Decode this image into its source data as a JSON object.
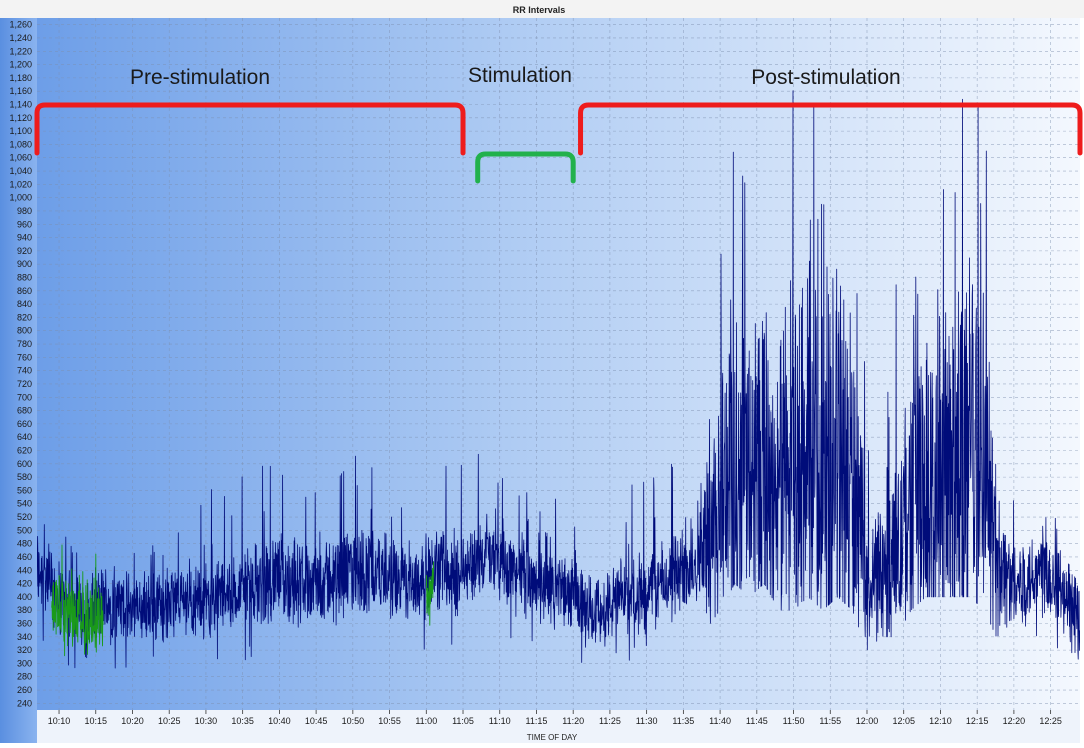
{
  "chart_data": {
    "type": "line",
    "title": "RR Intervals",
    "xlabel": "TIME OF DAY",
    "ylabel": "",
    "ylim": [
      230,
      1270
    ],
    "xlim_minutes": [
      607,
      749
    ],
    "y_ticks": [
      240,
      260,
      280,
      300,
      320,
      340,
      360,
      380,
      400,
      420,
      440,
      460,
      480,
      500,
      520,
      540,
      560,
      580,
      600,
      620,
      640,
      660,
      680,
      700,
      720,
      740,
      760,
      780,
      800,
      820,
      840,
      860,
      880,
      900,
      920,
      940,
      960,
      980,
      1000,
      1020,
      1040,
      1060,
      1080,
      1100,
      1120,
      1140,
      1160,
      1180,
      1200,
      1220,
      1240,
      1260
    ],
    "y_tick_labels": [
      "240",
      "260",
      "280",
      "300",
      "320",
      "340",
      "360",
      "380",
      "400",
      "420",
      "440",
      "460",
      "480",
      "500",
      "520",
      "540",
      "560",
      "580",
      "600",
      "620",
      "640",
      "660",
      "680",
      "700",
      "720",
      "740",
      "760",
      "780",
      "800",
      "820",
      "840",
      "860",
      "880",
      "900",
      "920",
      "940",
      "960",
      "980",
      "1,000",
      "1,020",
      "1,040",
      "1,060",
      "1,080",
      "1,100",
      "1,120",
      "1,140",
      "1,160",
      "1,180",
      "1,200",
      "1,220",
      "1,240",
      "1,260"
    ],
    "x_ticks": [
      "10:10",
      "10:15",
      "10:20",
      "10:25",
      "10:30",
      "10:35",
      "10:40",
      "10:45",
      "10:50",
      "10:55",
      "11:00",
      "11:05",
      "11:10",
      "11:15",
      "11:20",
      "11:25",
      "11:30",
      "11:35",
      "11:40",
      "11:45",
      "11:50",
      "11:55",
      "12:00",
      "12:05",
      "12:10",
      "12:15",
      "12:20",
      "12:25"
    ],
    "grid": true,
    "phases": [
      {
        "label": "Pre-stimulation",
        "start": "10:07",
        "end": "11:05",
        "color": "#ee1c1c"
      },
      {
        "label": "Stimulation",
        "start": "11:07",
        "end": "11:20",
        "color": "#22b14c"
      },
      {
        "label": "Post-stimulation",
        "start": "11:21",
        "end": "12:29",
        "color": "#ee1c1c"
      }
    ],
    "series": [
      {
        "color": "#000c7a",
        "x": [
          "10:07",
          "10:08",
          "10:09",
          "10:10",
          "10:11",
          "10:12",
          "10:13",
          "10:14",
          "10:15",
          "10:16",
          "10:18",
          "10:20",
          "10:22",
          "10:24",
          "10:26",
          "10:28",
          "10:30",
          "10:32",
          "10:34",
          "10:36",
          "10:38",
          "10:40",
          "10:42",
          "10:44",
          "10:46",
          "10:48",
          "10:50",
          "10:52",
          "10:54",
          "10:56",
          "10:58",
          "11:00",
          "11:02",
          "11:04",
          "11:06",
          "11:08",
          "11:10",
          "11:12",
          "11:14",
          "11:16",
          "11:18",
          "11:20",
          "11:22",
          "11:24",
          "11:26",
          "11:28",
          "11:30",
          "11:32",
          "11:34",
          "11:36",
          "11:38",
          "11:40",
          "11:42",
          "11:44",
          "11:46",
          "11:48",
          "11:50",
          "11:52",
          "11:54",
          "11:56",
          "11:58",
          "12:00",
          "12:02",
          "12:04",
          "12:06",
          "12:08",
          "12:10",
          "12:12",
          "12:14",
          "12:16",
          "12:18",
          "12:20",
          "12:22",
          "12:24",
          "12:26",
          "12:28",
          "12:29"
        ],
        "mean": [
          440,
          445,
          410,
          400,
          390,
          380,
          375,
          370,
          380,
          390,
          385,
          380,
          385,
          390,
          395,
          400,
          395,
          400,
          410,
          415,
          425,
          430,
          425,
          420,
          425,
          430,
          435,
          440,
          430,
          420,
          425,
          430,
          440,
          430,
          450,
          455,
          450,
          440,
          430,
          420,
          410,
          400,
          385,
          380,
          395,
          405,
          410,
          420,
          430,
          450,
          480,
          560,
          590,
          580,
          600,
          560,
          580,
          590,
          570,
          600,
          570,
          420,
          440,
          460,
          550,
          570,
          580,
          570,
          600,
          570,
          450,
          420,
          430,
          440,
          420,
          380,
          360
        ],
        "spread": [
          80,
          80,
          70,
          70,
          70,
          70,
          70,
          70,
          70,
          70,
          65,
          65,
          65,
          65,
          65,
          65,
          65,
          65,
          70,
          70,
          75,
          80,
          75,
          70,
          75,
          75,
          80,
          80,
          75,
          70,
          70,
          70,
          75,
          75,
          70,
          70,
          70,
          70,
          70,
          65,
          65,
          65,
          65,
          65,
          65,
          65,
          70,
          70,
          75,
          80,
          120,
          260,
          340,
          300,
          380,
          300,
          360,
          380,
          340,
          400,
          320,
          110,
          130,
          160,
          280,
          340,
          380,
          360,
          400,
          320,
          120,
          70,
          80,
          80,
          75,
          70,
          70
        ],
        "max": [
          560,
          560,
          520,
          500,
          490,
          480,
          470,
          470,
          480,
          490,
          500,
          520,
          530,
          540,
          550,
          560,
          560,
          570,
          580,
          590,
          600,
          610,
          600,
          590,
          600,
          610,
          620,
          640,
          620,
          590,
          600,
          610,
          620,
          610,
          620,
          640,
          620,
          600,
          590,
          570,
          560,
          560,
          540,
          540,
          560,
          580,
          590,
          600,
          620,
          660,
          780,
          1000,
          1100,
          1000,
          1180,
          1100,
          1260,
          1150,
          1120,
          1230,
          1080,
          700,
          720,
          900,
          1000,
          1120,
          1180,
          1200,
          1210,
          1180,
          700,
          560,
          560,
          560,
          520,
          500,
          480
        ],
        "min": [
          240,
          300,
          300,
          290,
          290,
          280,
          280,
          290,
          300,
          300,
          290,
          290,
          290,
          280,
          290,
          300,
          290,
          300,
          300,
          300,
          310,
          310,
          300,
          300,
          300,
          300,
          310,
          310,
          300,
          290,
          300,
          280,
          300,
          300,
          320,
          320,
          310,
          300,
          300,
          290,
          280,
          280,
          270,
          280,
          290,
          300,
          300,
          310,
          320,
          330,
          350,
          380,
          420,
          400,
          420,
          380,
          380,
          400,
          380,
          400,
          380,
          320,
          340,
          340,
          380,
          400,
          400,
          400,
          400,
          380,
          330,
          320,
          320,
          330,
          320,
          300,
          270
        ]
      },
      {
        "color": "#1a9a1a",
        "x": [
          "10:09",
          "10:10",
          "10:11",
          "10:12",
          "10:13",
          "10:14",
          "10:15",
          "10:16"
        ],
        "mean": [
          390,
          380,
          375,
          370,
          372,
          368,
          370,
          375
        ],
        "spread": [
          70,
          70,
          70,
          65,
          65,
          65,
          65,
          60
        ],
        "max": [
          480,
          480,
          490,
          470,
          480,
          460,
          470,
          460
        ],
        "min": [
          290,
          300,
          290,
          300,
          280,
          290,
          300,
          310
        ]
      },
      {
        "color": "#1a9a1a",
        "x": [
          "11:00",
          "11:01"
        ],
        "mean": [
          400,
          420
        ],
        "spread": [
          40,
          40
        ],
        "max": [
          460,
          480
        ],
        "min": [
          350,
          360
        ]
      }
    ]
  }
}
